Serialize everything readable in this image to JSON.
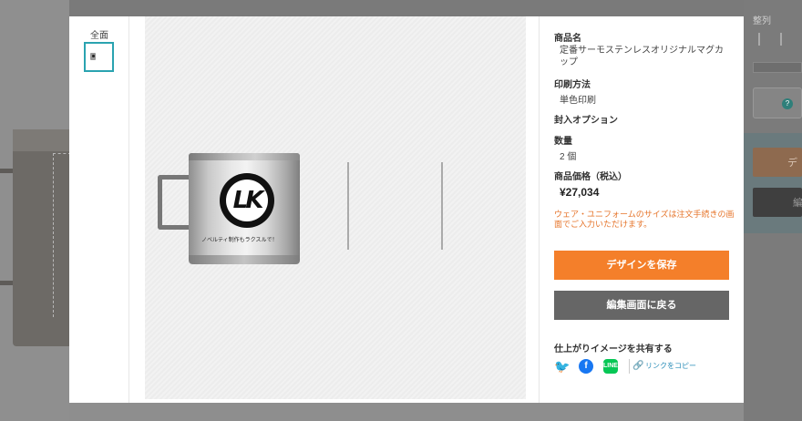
{
  "background": {
    "arrange_label": "整列",
    "help_icon": "?",
    "side_button_1": "デ",
    "side_button_2": "編"
  },
  "thumbnails": {
    "label": "全面"
  },
  "preview": {
    "mug_text": "ノベルティ制作もラクスルで！",
    "logo_letters": "LK"
  },
  "info": {
    "product_label": "商品名",
    "product_name": "定番サーモステンレスオリジナルマグカップ",
    "print_method_label": "印刷方法",
    "print_method": "単色印刷",
    "enclosure_label": "封入オプション",
    "quantity_label": "数量",
    "quantity": "2 個",
    "price_label": "商品価格（税込）",
    "price": "¥27,034",
    "note": "ウェア・ユニフォームのサイズは注文手続きの画面でご入力いただけます。",
    "save_button": "デザインを保存",
    "back_button": "編集画面に戻る",
    "share_label": "仕上がりイメージを共有する",
    "copy_link": "リンクをコピー"
  },
  "colors": {
    "accent_orange": "#f47f2a",
    "back_gray": "#666666",
    "note_orange": "#e6742a",
    "thumb_border": "#2aa3b0",
    "twitter": "#1da1f2",
    "facebook": "#1877f2",
    "line": "#06c755"
  },
  "icons": [
    "twitter-icon",
    "facebook-icon",
    "line-icon",
    "link-icon",
    "help-icon"
  ]
}
